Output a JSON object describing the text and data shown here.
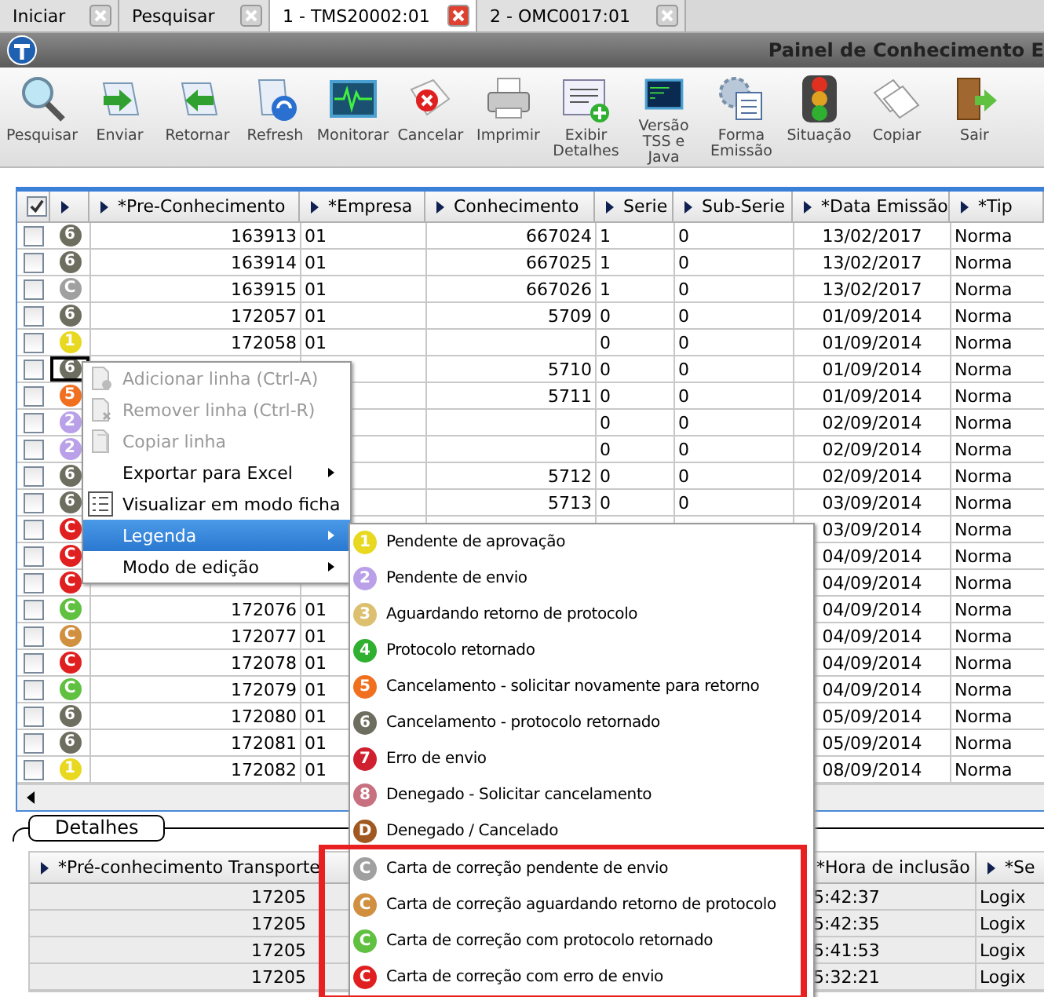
{
  "tabs": [
    {
      "label": "Iniciar",
      "selected": false
    },
    {
      "label": "Pesquisar",
      "selected": false
    },
    {
      "label": "1 - TMS20002:01",
      "selected": true
    },
    {
      "label": "2 - OMC0017:01",
      "selected": false
    }
  ],
  "window": {
    "title": "Painel de Conhecimento E"
  },
  "toolbar": [
    {
      "kind": "search",
      "label": "Pesquisar"
    },
    {
      "kind": "send",
      "label": "Enviar"
    },
    {
      "kind": "return",
      "label": "Retornar"
    },
    {
      "kind": "refresh",
      "label": "Refresh"
    },
    {
      "kind": "monitor",
      "label": "Monitorar"
    },
    {
      "kind": "cancel",
      "label": "Cancelar"
    },
    {
      "kind": "print",
      "label": "Imprimir"
    },
    {
      "kind": "details",
      "label": "Exibir Detalhes"
    },
    {
      "kind": "terminal",
      "label": "Versão TSS e Java"
    },
    {
      "kind": "form",
      "label": "Forma Emissão"
    },
    {
      "kind": "traffic-light",
      "label": "Situação"
    },
    {
      "kind": "copy",
      "label": "Copiar"
    },
    {
      "kind": "exit",
      "label": "Sair"
    }
  ],
  "grid": {
    "select_all_checked": true,
    "columns": [
      "*Pre-Conhecimento",
      "*Empresa",
      "Conhecimento",
      "Serie",
      "Sub-Serie",
      "*Data Emissão",
      "*Tip"
    ],
    "rows": [
      {
        "checked": false,
        "focused": false,
        "status": {
          "code": "6",
          "color": "#6e6e60"
        },
        "pre": "163913",
        "empresa": "01",
        "conhecimento": "667024",
        "serie": "1",
        "subserie": "0",
        "data": "13/02/2017",
        "tipo": "Norma"
      },
      {
        "checked": false,
        "focused": false,
        "status": {
          "code": "6",
          "color": "#6e6e60"
        },
        "pre": "163914",
        "empresa": "01",
        "conhecimento": "667025",
        "serie": "1",
        "subserie": "0",
        "data": "13/02/2017",
        "tipo": "Norma"
      },
      {
        "checked": false,
        "focused": false,
        "status": {
          "code": "C",
          "color": "#a0a0a0"
        },
        "pre": "163915",
        "empresa": "01",
        "conhecimento": "667026",
        "serie": "1",
        "subserie": "0",
        "data": "13/02/2017",
        "tipo": "Norma"
      },
      {
        "checked": false,
        "focused": false,
        "status": {
          "code": "6",
          "color": "#6e6e60"
        },
        "pre": "172057",
        "empresa": "01",
        "conhecimento": "5709",
        "serie": "0",
        "subserie": "0",
        "data": "01/09/2014",
        "tipo": "Norma"
      },
      {
        "checked": false,
        "focused": false,
        "status": {
          "code": "1",
          "color": "#e8d820"
        },
        "pre": "172058",
        "empresa": "01",
        "serie": "0",
        "subserie": "0",
        "data": "01/09/2014",
        "tipo": "Norma"
      },
      {
        "checked": false,
        "focused": true,
        "status": {
          "code": "6",
          "color": "#6e6e60"
        },
        "conhecimento": "5710",
        "serie": "0",
        "subserie": "0",
        "data": "01/09/2014",
        "tipo": "Norma"
      },
      {
        "checked": false,
        "focused": false,
        "status": {
          "code": "5",
          "color": "#f07020"
        },
        "conhecimento": "5711",
        "serie": "0",
        "subserie": "0",
        "data": "01/09/2014",
        "tipo": "Norma"
      },
      {
        "checked": false,
        "focused": false,
        "status": {
          "code": "2",
          "color": "#b9a0e8"
        },
        "serie": "0",
        "subserie": "0",
        "data": "02/09/2014",
        "tipo": "Norma"
      },
      {
        "checked": false,
        "focused": false,
        "status": {
          "code": "2",
          "color": "#b9a0e8"
        },
        "serie": "0",
        "subserie": "0",
        "data": "02/09/2014",
        "tipo": "Norma"
      },
      {
        "checked": false,
        "focused": false,
        "status": {
          "code": "6",
          "color": "#6e6e60"
        },
        "conhecimento": "5712",
        "serie": "0",
        "subserie": "0",
        "data": "02/09/2014",
        "tipo": "Norma"
      },
      {
        "checked": false,
        "focused": false,
        "status": {
          "code": "6",
          "color": "#6e6e60"
        },
        "conhecimento": "5713",
        "serie": "0",
        "subserie": "0",
        "data": "03/09/2014",
        "tipo": "Norma"
      },
      {
        "checked": false,
        "focused": false,
        "status": {
          "code": "C",
          "color": "#e02020"
        },
        "data": "03/09/2014",
        "tipo": "Norma"
      },
      {
        "checked": false,
        "focused": false,
        "status": {
          "code": "C",
          "color": "#e02020"
        },
        "data": "04/09/2014",
        "tipo": "Norma"
      },
      {
        "checked": false,
        "focused": false,
        "status": {
          "code": "C",
          "color": "#e02020"
        },
        "data": "04/09/2014",
        "tipo": "Norma"
      },
      {
        "checked": false,
        "focused": false,
        "status": {
          "code": "C",
          "color": "#60c040"
        },
        "pre": "172076",
        "empresa": "01",
        "data": "04/09/2014",
        "tipo": "Norma"
      },
      {
        "checked": false,
        "focused": false,
        "status": {
          "code": "C",
          "color": "#d09040"
        },
        "pre": "172077",
        "empresa": "01",
        "data": "04/09/2014",
        "tipo": "Norma"
      },
      {
        "checked": false,
        "focused": false,
        "status": {
          "code": "C",
          "color": "#e02020"
        },
        "pre": "172078",
        "empresa": "01",
        "data": "04/09/2014",
        "tipo": "Norma"
      },
      {
        "checked": false,
        "focused": false,
        "status": {
          "code": "C",
          "color": "#60c040"
        },
        "pre": "172079",
        "empresa": "01",
        "data": "04/09/2014",
        "tipo": "Norma"
      },
      {
        "checked": false,
        "focused": false,
        "status": {
          "code": "6",
          "color": "#6e6e60"
        },
        "pre": "172080",
        "empresa": "01",
        "data": "05/09/2014",
        "tipo": "Norma"
      },
      {
        "checked": false,
        "focused": false,
        "status": {
          "code": "6",
          "color": "#6e6e60"
        },
        "pre": "172081",
        "empresa": "01",
        "data": "05/09/2014",
        "tipo": "Norma"
      },
      {
        "checked": false,
        "focused": false,
        "status": {
          "code": "1",
          "color": "#e8d820"
        },
        "pre": "172082",
        "empresa": "01",
        "data": "08/09/2014",
        "tipo": "Norma"
      }
    ]
  },
  "context_menu": [
    {
      "kind": "add-row",
      "label": "Adicionar linha (Ctrl-A)",
      "disabled": true,
      "submenu": false,
      "selected": false
    },
    {
      "kind": "remove-row",
      "label": "Remover linha (Ctrl-R)",
      "disabled": true,
      "submenu": false,
      "selected": false
    },
    {
      "kind": "copy-row",
      "label": "Copiar linha",
      "disabled": true,
      "submenu": false,
      "selected": false
    },
    {
      "kind": "plain",
      "label": "Exportar para Excel",
      "disabled": false,
      "submenu": true,
      "selected": false
    },
    {
      "kind": "form-view",
      "label": "Visualizar em modo ficha",
      "disabled": false,
      "submenu": false,
      "selected": false
    },
    {
      "kind": "plain",
      "label": "Legenda",
      "disabled": false,
      "submenu": true,
      "selected": true
    },
    {
      "kind": "plain",
      "label": "Modo de edição",
      "disabled": false,
      "submenu": true,
      "selected": false
    }
  ],
  "legend": [
    {
      "code": "1",
      "color": "#e8d820",
      "label": "Pendente de aprovação",
      "highlighted": false
    },
    {
      "code": "2",
      "color": "#b9a0e8",
      "label": "Pendente de envio",
      "highlighted": false
    },
    {
      "code": "3",
      "color": "#dcc070",
      "label": "Aguardando retorno de protocolo",
      "highlighted": false
    },
    {
      "code": "4",
      "color": "#30b030",
      "label": "Protocolo retornado",
      "highlighted": false
    },
    {
      "code": "5",
      "color": "#f07020",
      "label": "Cancelamento - solicitar novamente para retorno",
      "highlighted": false
    },
    {
      "code": "6",
      "color": "#6e6e60",
      "label": "Cancelamento - protocolo retornado",
      "highlighted": false
    },
    {
      "code": "7",
      "color": "#d02030",
      "label": "Erro de envio",
      "highlighted": false
    },
    {
      "code": "8",
      "color": "#c87080",
      "label": "Denegado - Solicitar cancelamento",
      "highlighted": false
    },
    {
      "code": "D",
      "color": "#a05820",
      "label": "Denegado / Cancelado",
      "highlighted": false
    },
    {
      "code": "C",
      "color": "#a0a0a0",
      "label": "Carta de correção pendente de envio",
      "highlighted": true
    },
    {
      "code": "C",
      "color": "#d09040",
      "label": "Carta de correção aguardando retorno de protocolo",
      "highlighted": true
    },
    {
      "code": "C",
      "color": "#60c040",
      "label": "Carta de correção com protocolo retornado",
      "highlighted": true
    },
    {
      "code": "C",
      "color": "#e02020",
      "label": "Carta de correção com erro de envio",
      "highlighted": true
    }
  ],
  "details": {
    "title": "Detalhes",
    "columns": [
      {
        "label": "*Pré-conhecimento Transporte",
        "marker": true
      },
      {
        "label": "*Hora de inclusão",
        "marker": false
      },
      {
        "label": "*Se",
        "marker": true
      }
    ],
    "rows": [
      {
        "pre": "17205",
        "hora": "5:42:37",
        "sistema": "Logix"
      },
      {
        "pre": "17205",
        "hora": "5:42:35",
        "sistema": "Logix"
      },
      {
        "pre": "17205",
        "hora": "5:41:53",
        "sistema": "Logix"
      },
      {
        "pre": "17205",
        "hora": "5:32:21",
        "sistema": "Logix"
      }
    ]
  }
}
